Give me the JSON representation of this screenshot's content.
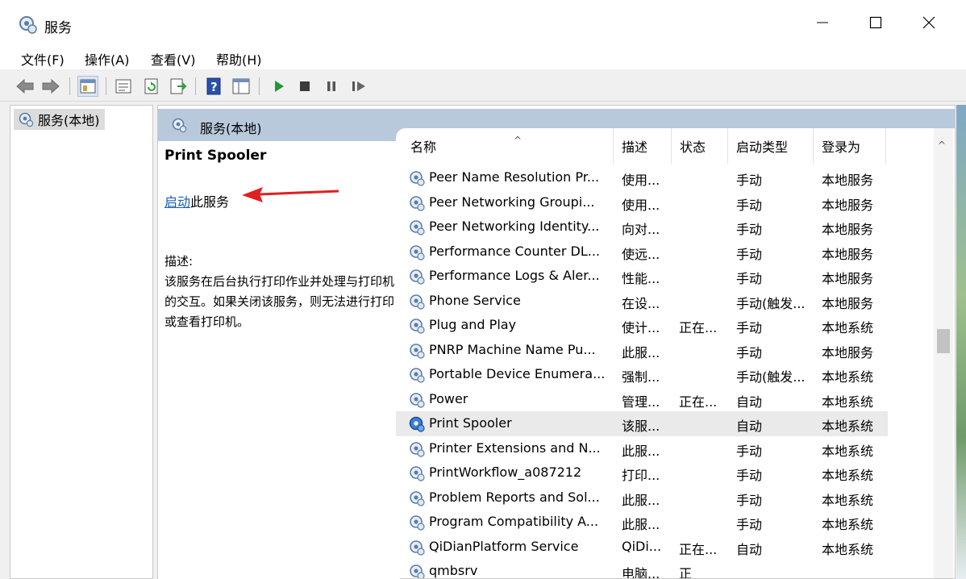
{
  "window": {
    "title": "服务"
  },
  "menu": [
    "文件(F)",
    "操作(A)",
    "查看(V)",
    "帮助(H)"
  ],
  "tree": {
    "root_label": "服务(本地)"
  },
  "pane_header": "服务(本地)",
  "detail": {
    "service_name": "Print Spooler",
    "start_link": "启动",
    "start_suffix": "此服务",
    "desc_label": "描述:",
    "description": "该服务在后台执行打印作业并处理与打印机的交互。如果关闭该服务，则无法进行打印或查看打印机。"
  },
  "columns": [
    "名称",
    "描述",
    "状态",
    "启动类型",
    "登录为"
  ],
  "rows": [
    {
      "name": "Peer Name Resolution Pr...",
      "desc": "使用...",
      "status": "",
      "startup": "手动",
      "logon": "本地服务"
    },
    {
      "name": "Peer Networking Groupi...",
      "desc": "使用...",
      "status": "",
      "startup": "手动",
      "logon": "本地服务"
    },
    {
      "name": "Peer Networking Identity...",
      "desc": "向对...",
      "status": "",
      "startup": "手动",
      "logon": "本地服务"
    },
    {
      "name": "Performance Counter DL...",
      "desc": "使远...",
      "status": "",
      "startup": "手动",
      "logon": "本地服务"
    },
    {
      "name": "Performance Logs & Aler...",
      "desc": "性能...",
      "status": "",
      "startup": "手动",
      "logon": "本地服务"
    },
    {
      "name": "Phone Service",
      "desc": "在设...",
      "status": "",
      "startup": "手动(触发...",
      "logon": "本地服务"
    },
    {
      "name": "Plug and Play",
      "desc": "使计...",
      "status": "正在...",
      "startup": "手动",
      "logon": "本地系统"
    },
    {
      "name": "PNRP Machine Name Pu...",
      "desc": "此服...",
      "status": "",
      "startup": "手动",
      "logon": "本地服务"
    },
    {
      "name": "Portable Device Enumera...",
      "desc": "强制...",
      "status": "",
      "startup": "手动(触发...",
      "logon": "本地系统"
    },
    {
      "name": "Power",
      "desc": "管理...",
      "status": "正在...",
      "startup": "自动",
      "logon": "本地系统"
    },
    {
      "name": "Print Spooler",
      "desc": "该服...",
      "status": "",
      "startup": "自动",
      "logon": "本地系统"
    },
    {
      "name": "Printer Extensions and N...",
      "desc": "此服...",
      "status": "",
      "startup": "手动",
      "logon": "本地系统"
    },
    {
      "name": "PrintWorkflow_a087212",
      "desc": "打印...",
      "status": "",
      "startup": "手动",
      "logon": "本地系统"
    },
    {
      "name": "Problem Reports and Sol...",
      "desc": "此服...",
      "status": "",
      "startup": "手动",
      "logon": "本地系统"
    },
    {
      "name": "Program Compatibility A...",
      "desc": "此服...",
      "status": "",
      "startup": "手动",
      "logon": "本地系统"
    },
    {
      "name": "QiDianPlatform Service",
      "desc": "QiDi...",
      "status": "正在...",
      "startup": "自动",
      "logon": "本地系统"
    },
    {
      "name": "qmbsrv",
      "desc": "电脑...",
      "status": "正",
      "startup": "",
      "logon": ""
    }
  ],
  "selected_row": "Print Spooler",
  "accent_color": "#1a5fb4",
  "arrow_color": "#e02020"
}
